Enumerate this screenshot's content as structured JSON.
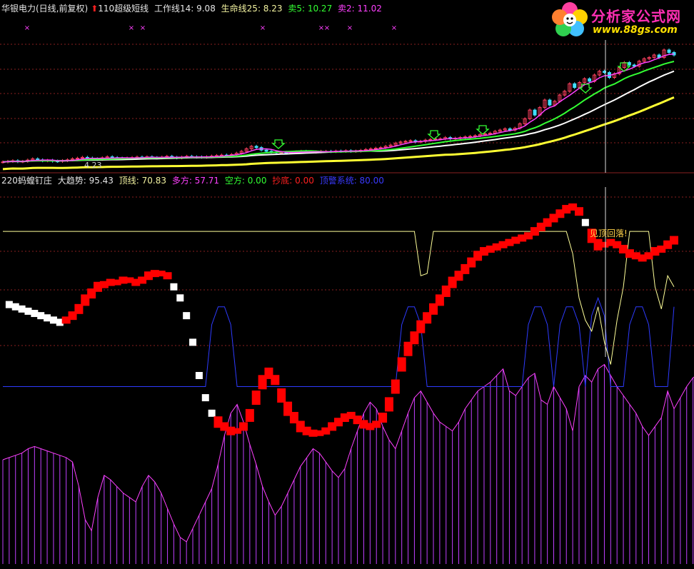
{
  "header_top": {
    "stock": "华银电力(日线,前复权)",
    "arrow_icon": "up-arrow-icon",
    "indicator": "110超级短线",
    "work_line": "工作线14: 9.08",
    "life_line": "生命线25: 8.23",
    "sell5": "卖5: 10.27",
    "sell2": "卖2: 11.02"
  },
  "header_sub": {
    "indicator": "220蚂蝗钉庄",
    "trend": "大趋势: 95.43",
    "top_line": "顶线: 70.83",
    "bull": "多方: 57.71",
    "bear": "空方: 0.00",
    "bottom_buy": "抄底: 0.00",
    "warning_system": "顶警系统: 80.00"
  },
  "logo": {
    "title": "分析家公式网",
    "url": "www.88gs.com"
  },
  "annotations": {
    "top_warning": "见顶回落!",
    "price_low": "4.23"
  },
  "colors": {
    "background": "#000000",
    "grid": "#8a1f1f",
    "red_band": "#ff0000",
    "white_blocks": "#ffffff",
    "yellow_line": "#ffff99",
    "blue_line": "#2e3bff",
    "magenta_bars": "#c040ff",
    "magenta_line": "#ff40ff",
    "green_line": "#33ff33",
    "white_ma": "#ffffff",
    "yellow_ma": "#ffff33",
    "buy_arrow": "#33ff33",
    "sell_mark": "#ff40ff"
  },
  "chart_data": [
    {
      "type": "candlestick",
      "ylim": [
        3.5,
        14
      ],
      "close": [
        4.25,
        4.3,
        4.35,
        4.28,
        4.3,
        4.4,
        4.5,
        4.42,
        4.35,
        4.38,
        4.32,
        4.3,
        4.36,
        4.42,
        4.5,
        4.55,
        4.62,
        4.56,
        4.5,
        4.46,
        4.58,
        4.66,
        4.6,
        4.55,
        4.53,
        4.56,
        4.6,
        4.64,
        4.62,
        4.66,
        4.6,
        4.58,
        4.64,
        4.7,
        4.62,
        4.58,
        4.64,
        4.7,
        4.66,
        4.65,
        4.64,
        4.67,
        4.72,
        4.76,
        4.8,
        4.78,
        4.85,
        4.95,
        5.1,
        5.3,
        5.5,
        5.4,
        5.2,
        5.1,
        5.05,
        5.0,
        5.02,
        4.98,
        5.02,
        5.05,
        5.1,
        5.06,
        5.04,
        5.06,
        5.1,
        5.1,
        5.08,
        5.12,
        5.1,
        5.15,
        5.1,
        5.12,
        5.18,
        5.25,
        5.3,
        5.35,
        5.4,
        5.5,
        5.6,
        5.75,
        5.85,
        5.9,
        5.95,
        5.85,
        5.9,
        6.0,
        6.05,
        6.1,
        6.1,
        6.2,
        6.1,
        6.15,
        6.2,
        6.25,
        6.3,
        6.35,
        6.45,
        6.5,
        6.55,
        6.7,
        6.8,
        6.9,
        6.8,
        6.95,
        7.3,
        7.7,
        8.4,
        8.0,
        8.6,
        9.2,
        8.8,
        9.1,
        9.6,
        9.9,
        10.5,
        10.2,
        10.6,
        10.9,
        10.7,
        11.2,
        11.5,
        11.4,
        11.0,
        11.3,
        11.8,
        12.2,
        12.0,
        11.9,
        12.3,
        12.5,
        12.6,
        12.8,
        12.6,
        13.2,
        13.0,
        12.8
      ]
    },
    {
      "type": "mixed",
      "ylim": [
        -40,
        130
      ],
      "red_band": [
        78,
        77,
        76,
        75,
        74,
        73,
        72,
        71,
        70,
        69,
        70,
        72,
        75,
        79,
        82,
        85,
        86,
        87,
        87,
        88,
        88,
        87,
        88,
        90,
        91,
        91,
        90,
        85,
        80,
        72,
        60,
        45,
        35,
        28,
        24,
        22,
        20,
        20,
        22,
        27,
        35,
        42,
        46,
        43,
        36,
        30,
        26,
        22,
        20,
        19,
        19,
        20,
        22,
        24,
        26,
        27,
        25,
        23,
        22,
        23,
        26,
        32,
        40,
        50,
        57,
        62,
        67,
        71,
        75,
        79,
        83,
        87,
        90,
        93,
        96,
        99,
        101,
        102,
        103,
        104,
        105,
        106,
        107,
        108,
        110,
        112,
        114,
        116,
        118,
        120,
        121,
        119,
        114,
        108,
        104,
        104,
        105,
        104,
        102,
        100,
        99,
        98,
        99,
        101,
        102,
        104,
        106
      ],
      "yellow_line": [
        110,
        110,
        110,
        110,
        110,
        110,
        110,
        110,
        110,
        110,
        110,
        110,
        110,
        110,
        110,
        110,
        110,
        110,
        110,
        110,
        110,
        110,
        110,
        110,
        110,
        110,
        110,
        110,
        110,
        110,
        110,
        110,
        110,
        110,
        110,
        110,
        110,
        110,
        110,
        110,
        110,
        110,
        110,
        110,
        110,
        110,
        110,
        110,
        110,
        110,
        110,
        110,
        110,
        110,
        110,
        110,
        110,
        110,
        110,
        110,
        110,
        110,
        110,
        110,
        110,
        110,
        90,
        91,
        110,
        110,
        110,
        110,
        110,
        110,
        110,
        110,
        110,
        110,
        110,
        110,
        110,
        110,
        110,
        110,
        110,
        110,
        110,
        110,
        110,
        110,
        100,
        80,
        70,
        65,
        76,
        60,
        50,
        70,
        85,
        110,
        110,
        110,
        110,
        85,
        75,
        90,
        85
      ],
      "blue_line": [
        40,
        40,
        40,
        40,
        40,
        40,
        40,
        40,
        40,
        40,
        40,
        40,
        40,
        40,
        40,
        40,
        40,
        40,
        40,
        40,
        40,
        40,
        40,
        40,
        40,
        40,
        40,
        40,
        40,
        40,
        40,
        40,
        40,
        40,
        40,
        40,
        40,
        40,
        40,
        40,
        40,
        40,
        40,
        40,
        40,
        40,
        40,
        40,
        40,
        40,
        40,
        40,
        40,
        40,
        40,
        40,
        40,
        40,
        40,
        40,
        40,
        40,
        40,
        40,
        40,
        40,
        40,
        40,
        40,
        40,
        40,
        40,
        40,
        40,
        40,
        40,
        40,
        40,
        40,
        40,
        40,
        40,
        40,
        40,
        40,
        40,
        40,
        40,
        40,
        40,
        40,
        40,
        40,
        40,
        40,
        40,
        40,
        40,
        40,
        40,
        40,
        40,
        40,
        40,
        40,
        40,
        40
      ],
      "magenta_bars": [
        7,
        8,
        9,
        10,
        12,
        13,
        12,
        11,
        10,
        9,
        8,
        6,
        -5,
        -20,
        -25,
        -10,
        0,
        -2,
        -5,
        -8,
        -10,
        -12,
        -5,
        0,
        -3,
        -8,
        -15,
        -22,
        -28,
        -30,
        -24,
        -18,
        -12,
        -6,
        5,
        18,
        28,
        32,
        24,
        14,
        5,
        -5,
        -12,
        -18,
        -14,
        -8,
        -2,
        4,
        8,
        12,
        10,
        6,
        2,
        -1,
        3,
        12,
        20,
        28,
        33,
        30,
        22,
        16,
        12,
        20,
        28,
        35,
        38,
        33,
        28,
        24,
        22,
        20,
        24,
        30,
        34,
        38,
        40,
        42,
        45,
        48,
        38,
        36,
        40,
        44,
        46,
        34,
        32,
        40,
        35,
        30,
        20,
        40,
        45,
        42,
        48,
        50,
        45,
        40,
        36,
        32,
        28,
        22,
        18,
        22,
        26,
        38,
        30,
        35,
        40,
        44,
        46,
        40,
        35
      ]
    }
  ]
}
